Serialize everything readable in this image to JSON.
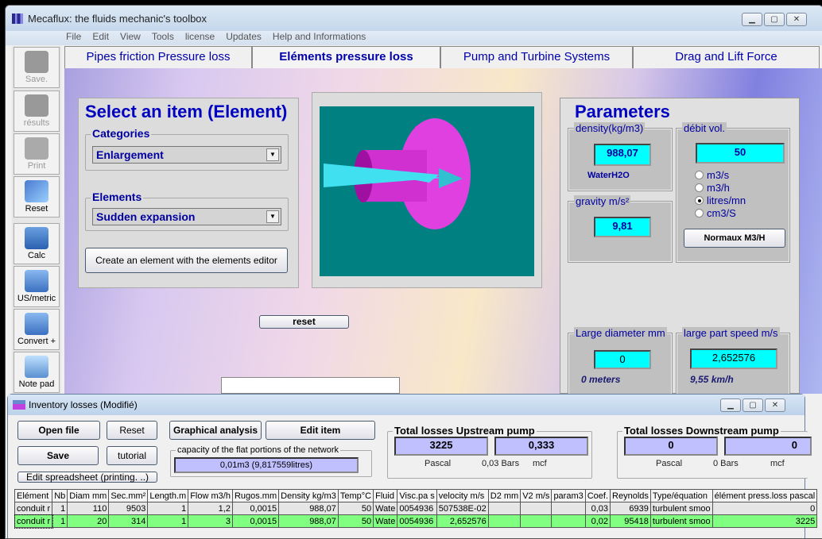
{
  "window": {
    "title": "Mecaflux: the fluids mechanic's toolbox"
  },
  "menu": [
    "File",
    "Edit",
    "View",
    "Tools",
    "license",
    "Updates",
    "Help and Informations"
  ],
  "toolbar": [
    {
      "label": "Save.",
      "icon": "save-icon",
      "enabled": false
    },
    {
      "label": "résults",
      "icon": "results-icon",
      "enabled": false
    },
    {
      "label": "Print",
      "icon": "print-icon",
      "enabled": false
    },
    {
      "label": "Reset",
      "icon": "reset-icon",
      "enabled": true
    },
    {
      "label": "Calc",
      "icon": "calculator-icon",
      "enabled": true
    },
    {
      "label": "US/metric",
      "icon": "computer-icon",
      "enabled": true
    },
    {
      "label": "Convert +",
      "icon": "computer-icon",
      "enabled": true
    },
    {
      "label": "Note pad",
      "icon": "notepad-icon",
      "enabled": true
    }
  ],
  "tabs": [
    {
      "label": "Pipes friction Pressure loss"
    },
    {
      "label": "Eléments pressure loss",
      "active": true
    },
    {
      "label": "Pump and Turbine Systems"
    },
    {
      "label": "Drag and Lift Force"
    }
  ],
  "select": {
    "title": "Select an item (Element)",
    "categories_label": "Categories",
    "category": "Enlargement",
    "elements_label": "Elements",
    "element": "Sudden expansion",
    "create_button": "Create an element with the elements editor",
    "reset_button": "reset"
  },
  "parameters": {
    "title": "Parameters",
    "density_label": "density(kg/m3)",
    "density": "988,07",
    "fluid": "WaterH2O",
    "gravity_label": "gravity m/s²",
    "gravity": "9,81",
    "flow_label": "débit vol.",
    "flow": "50",
    "units": [
      "m3/s",
      "m3/h",
      "litres/mn",
      "cm3/S"
    ],
    "selected_unit": "litres/mn",
    "normal_button": "Normaux M3/H",
    "large_diameter_label": "Large diameter mm",
    "large_diameter": "0",
    "large_diameter_m": "0 meters",
    "speed_label": "large part speed  m/s",
    "speed": "2,652576",
    "speed_kmh": "9,55 km/h"
  },
  "inventory": {
    "title": "Inventory losses (Modifié)",
    "open_file": "Open file",
    "reset": "Reset",
    "save": "Save",
    "tutorial": "tutorial",
    "edit_spreadsheet": "Edit spreadsheet (printing. ..)",
    "graphical": "Graphical analysis",
    "edit_item": "Edit item",
    "capacity_label": "capacity of the flat portions of the network",
    "capacity": "0,01m3 (9,817559litres)",
    "upstream": {
      "title": "Total losses Upstream pump",
      "pascal": "3225",
      "mcf": "0,333",
      "pascal_unit": "Pascal",
      "bars": "0,03 Bars",
      "mcf_unit": "mcf"
    },
    "downstream": {
      "title": "Total losses  Downstream pump",
      "pascal": "0",
      "mcf": "0",
      "pascal_unit": "Pascal",
      "bars": "0 Bars",
      "mcf_unit": "mcf"
    },
    "columns": [
      "Elément",
      "Nb",
      "Diam mm",
      "Sec.mm²",
      "Length.m",
      "Flow m3/h",
      "Rugos.mm",
      "Density kg/m3",
      "Temp°C",
      "Fluid",
      "Visc.pa s",
      "velocity m/s",
      "D2 mm",
      "V2 m/s",
      "param3",
      "Coef.",
      "Reynolds",
      "Type/équation",
      "élément press.loss pascal"
    ],
    "rows": [
      [
        "conduit r",
        "1",
        "110",
        "9503",
        "1",
        "1,2",
        "0,0015",
        "988,07",
        "50",
        "Wate",
        "0054936",
        "507538E-02",
        "",
        "",
        "",
        "0,03",
        "6939",
        "turbulent smoo",
        "0"
      ],
      [
        "conduit r",
        "1",
        "20",
        "314",
        "1",
        "3",
        "0,0015",
        "988,07",
        "50",
        "Wate",
        "0054936",
        "2,652576",
        "",
        "",
        "",
        "0,02",
        "95418",
        "turbulent smoo",
        "3225"
      ]
    ]
  }
}
